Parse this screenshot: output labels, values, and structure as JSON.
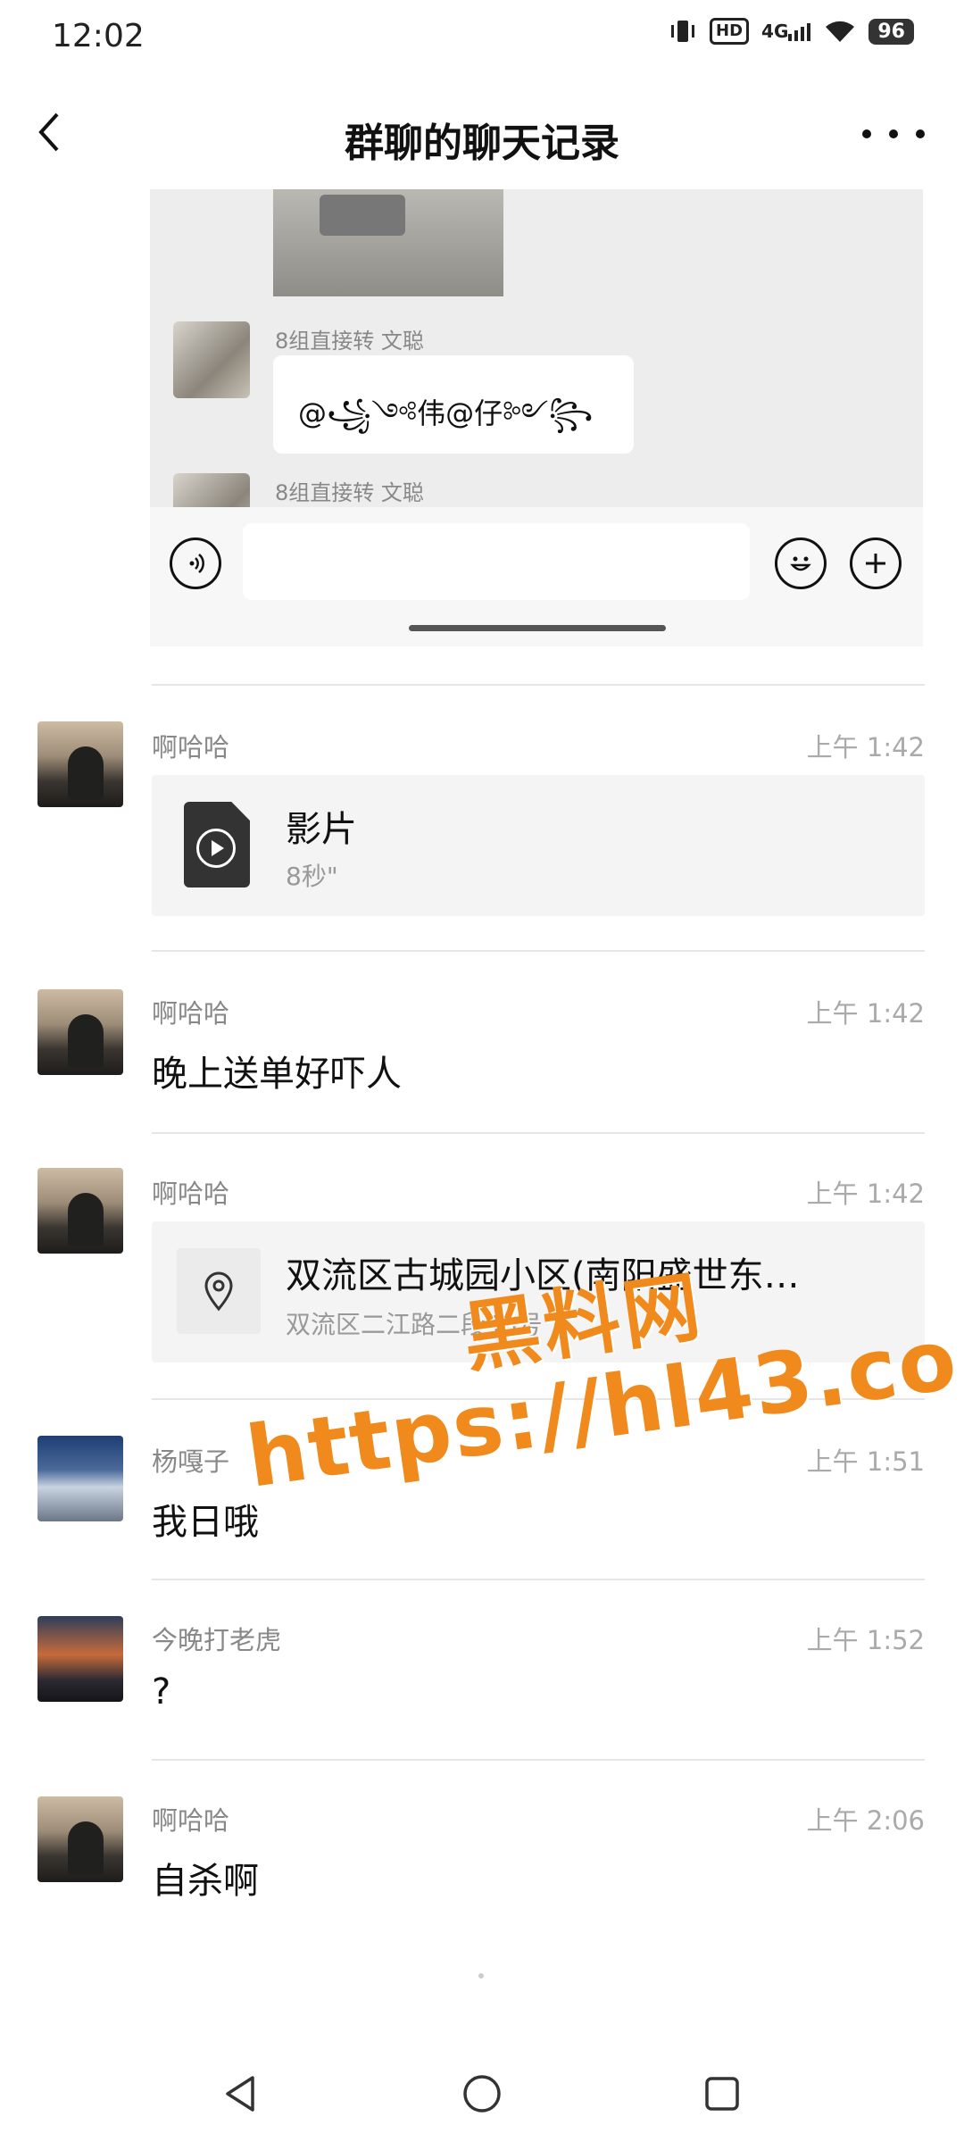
{
  "status_bar": {
    "time": "12:02",
    "hd": "HD",
    "network": "4G",
    "battery": "96"
  },
  "header": {
    "title": "群聊的聊天记录"
  },
  "embedded_chat": {
    "sender_1": "8组直接转  文聪",
    "bubble_text": "@꧁༺伟@仔༻꧂",
    "sender_2": "8组直接转  文聪"
  },
  "messages": [
    {
      "sender": "啊哈哈",
      "time": "上午 1:42",
      "type": "file",
      "file_name": "影片",
      "file_meta": "8秒\""
    },
    {
      "sender": "啊哈哈",
      "time": "上午 1:42",
      "type": "text",
      "text": "晚上送单好吓人"
    },
    {
      "sender": "啊哈哈",
      "time": "上午 1:42",
      "type": "location",
      "loc_title": "双流区古城园小区(南阳盛世东…",
      "loc_addr": "双流区二江路二段48号"
    },
    {
      "sender": "杨嘎子",
      "time": "上午 1:51",
      "type": "text",
      "text": "我日哦"
    },
    {
      "sender": "今晚打老虎",
      "time": "上午 1:52",
      "type": "text",
      "text": "?"
    },
    {
      "sender": "啊哈哈",
      "time": "上午 2:06",
      "type": "text",
      "text": "自杀啊"
    }
  ],
  "watermark": {
    "title": "黑料网",
    "url": "https://hl43.co"
  },
  "colors": {
    "watermark": "#f08a1c",
    "card_bg": "#f4f4f4"
  }
}
